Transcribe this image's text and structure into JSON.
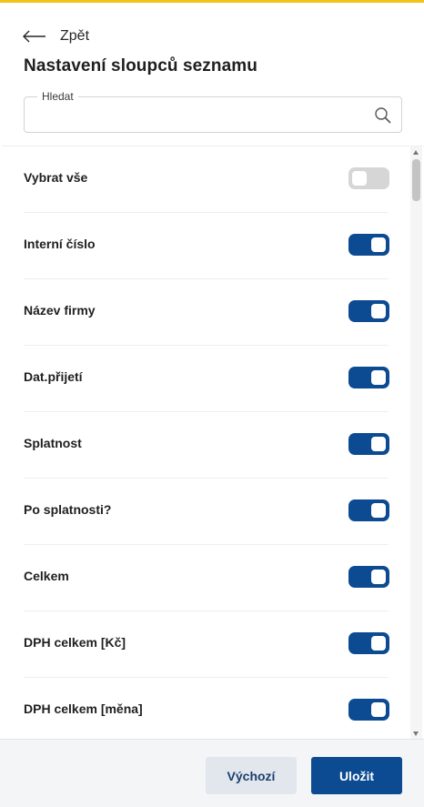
{
  "header": {
    "back_label": "Zpět",
    "title": "Nastavení sloupců seznamu"
  },
  "search": {
    "legend": "Hledat",
    "value": "",
    "placeholder": ""
  },
  "columns": [
    {
      "label": "Vybrat vše",
      "enabled": false
    },
    {
      "label": "Interní číslo",
      "enabled": true
    },
    {
      "label": "Název firmy",
      "enabled": true
    },
    {
      "label": "Dat.přijetí",
      "enabled": true
    },
    {
      "label": "Splatnost",
      "enabled": true
    },
    {
      "label": "Po splatnosti?",
      "enabled": true
    },
    {
      "label": "Celkem",
      "enabled": true
    },
    {
      "label": "DPH celkem [Kč]",
      "enabled": true
    },
    {
      "label": "DPH celkem [měna]",
      "enabled": true
    }
  ],
  "footer": {
    "default_label": "Výchozí",
    "save_label": "Uložit"
  },
  "colors": {
    "accent": "#f2c21b",
    "primary": "#0c4a92",
    "toggle_off": "#d6d6d6"
  },
  "icons": {
    "back": "arrow-left-icon",
    "search": "search-icon"
  }
}
